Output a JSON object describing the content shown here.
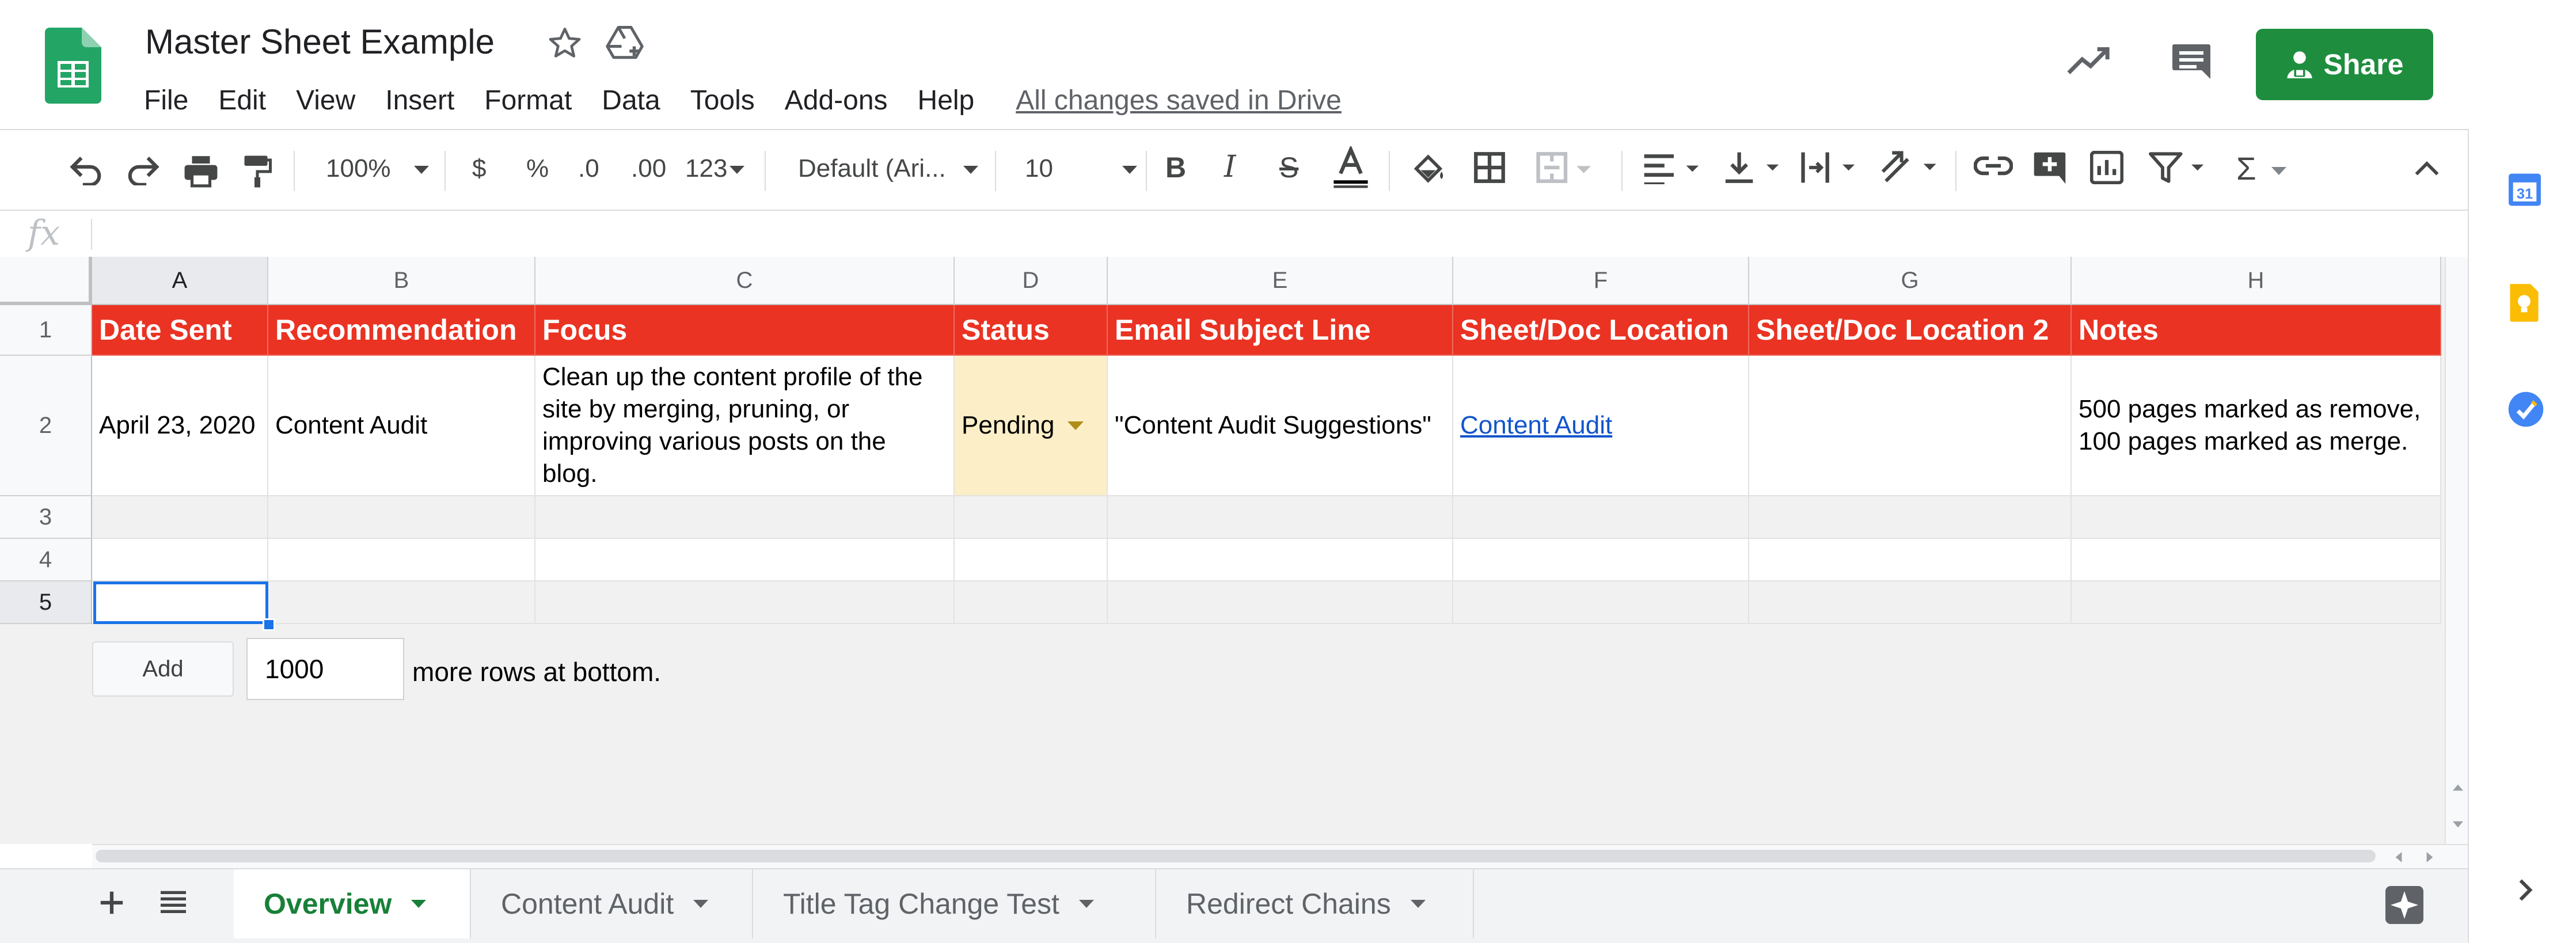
{
  "app": {
    "doc_title": "Master Sheet Example",
    "saved_status": "All changes saved in Drive",
    "share_label": "Share",
    "calendar_day": "31"
  },
  "menu": [
    "File",
    "Edit",
    "View",
    "Insert",
    "Format",
    "Data",
    "Tools",
    "Add-ons",
    "Help"
  ],
  "toolbar": {
    "zoom": "100%",
    "currency": "$",
    "percent": "%",
    "decrease_decimal": ".0",
    "increase_decimal": ".00",
    "more_formats": "123",
    "font": "Default (Ari...",
    "font_size": "10",
    "sigma": "Σ"
  },
  "formula_bar": {
    "fx": "fx",
    "value": ""
  },
  "columns": [
    "A",
    "B",
    "C",
    "D",
    "E",
    "F",
    "G",
    "H"
  ],
  "rows": [
    "1",
    "2",
    "3",
    "4",
    "5"
  ],
  "sheet": {
    "header": [
      "Date Sent",
      "Recommendation",
      "Focus",
      "Status",
      "Email Subject Line",
      "Sheet/Doc Location",
      "Sheet/Doc Location 2",
      "Notes"
    ],
    "row2": {
      "date": "April 23, 2020",
      "recommendation": "Content Audit",
      "focus": "Clean up the content profile of the site by merging, pruning, or improving various posts on the blog.",
      "status": "Pending",
      "email_subject": "\"Content Audit Suggestions\"",
      "location": "Content Audit",
      "location2": "",
      "notes": "500 pages marked as remove, 100 pages marked as merge."
    }
  },
  "add_rows": {
    "button": "Add",
    "count": "1000",
    "suffix": "more rows at bottom."
  },
  "tabs": [
    "Overview",
    "Content Audit",
    "Title Tag Change Test",
    "Redirect Chains"
  ],
  "colors": {
    "header_bg": "#ea3323",
    "accent_green": "#1e8e3e",
    "pending_bg": "#fcefc7",
    "link": "#1155cc",
    "selection": "#1a73e8"
  }
}
